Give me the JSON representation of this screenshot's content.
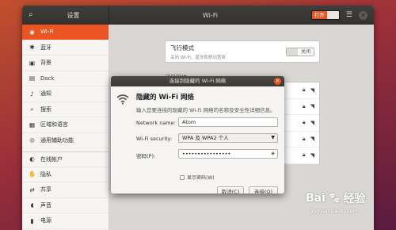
{
  "window": {
    "sidebar_title": "设置",
    "page_title": "Wi-Fi",
    "toggle_label": "打开"
  },
  "sidebar": {
    "items": [
      {
        "icon": "wifi-icon",
        "glyph": "◉",
        "label": "Wi-Fi"
      },
      {
        "icon": "bluetooth-icon",
        "glyph": "✱",
        "label": "蓝牙"
      },
      {
        "icon": "background-icon",
        "glyph": "▣",
        "label": "背景"
      },
      {
        "icon": "dock-icon",
        "glyph": "▤",
        "label": "Dock"
      },
      {
        "icon": "notification-icon",
        "glyph": "♪",
        "label": "通知"
      },
      {
        "icon": "search-icon",
        "glyph": "⌕",
        "label": "搜索"
      },
      {
        "icon": "region-language-icon",
        "glyph": "▦",
        "label": "区域和语言"
      },
      {
        "icon": "accessibility-icon",
        "glyph": "◎",
        "label": "通用辅助功能"
      },
      {
        "icon": "online-accounts-icon",
        "glyph": "◐",
        "label": "在线帐户"
      },
      {
        "icon": "privacy-icon",
        "glyph": "✋",
        "label": "隐私"
      },
      {
        "icon": "sharing-icon",
        "glyph": "⇄",
        "label": "共享"
      },
      {
        "icon": "sound-icon",
        "glyph": "◖",
        "label": "声音"
      },
      {
        "icon": "power-icon",
        "glyph": "▮",
        "label": "电源"
      }
    ]
  },
  "content": {
    "airplane_title": "飞行模式",
    "airplane_sub": "关闭 Wi-Fi、蓝牙和移动宽带",
    "airplane_toggle": "关闭",
    "networks_heading": "可见网络"
  },
  "dialog": {
    "title": "连接到隐藏的 Wi-Fi 网络",
    "heading": "隐藏的 Wi-Fi 网络",
    "description": "输入您要连接的隐藏的 Wi-Fi 网络的名称及安全性详细信息。",
    "network_name_label": "Network name:",
    "network_name_value": "Atom",
    "security_label": "Wi-Fi security:",
    "security_value": "WPA 及 WPA2 个人",
    "password_label": "密码(P):",
    "password_value": "••••••••••••••••",
    "show_password_label": "显示密码(W)",
    "cancel_label": "取消(C)",
    "connect_label": "连接(O)"
  },
  "watermark": {
    "logo_text_1": "Bai",
    "logo_text_2": "经验",
    "url": "jingyan.baidu.com"
  },
  "colors": {
    "accent": "#e95420",
    "titlebar": "#3c3b37"
  }
}
